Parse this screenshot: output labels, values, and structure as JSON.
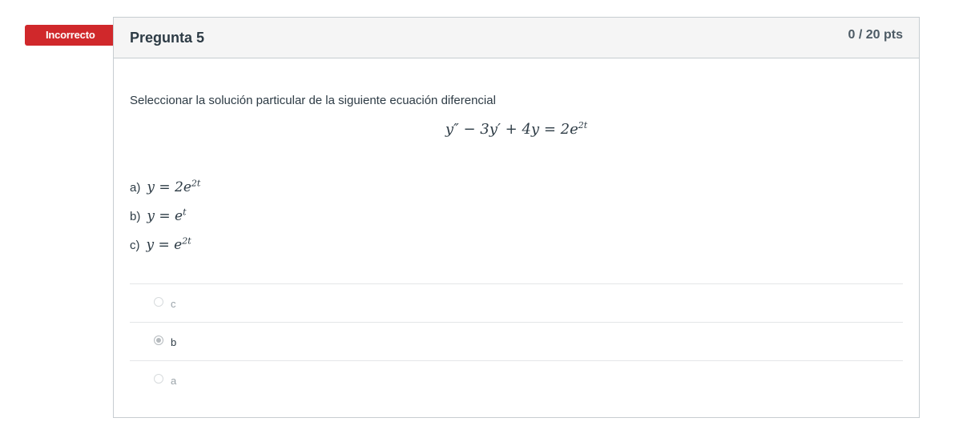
{
  "status_badge": "Incorrecto",
  "question": {
    "title": "Pregunta 5",
    "points": "0 / 20 pts",
    "prompt": "Seleccionar la solución particular de la siguiente ecuación diferencial",
    "equation": {
      "lhs": "y″ − 3y′ + 4y = 2e",
      "exp": "2t"
    },
    "options": [
      {
        "label": "a)",
        "math": "y = 2e",
        "exp": "2t"
      },
      {
        "label": "b)",
        "math": "y = e",
        "exp": "t"
      },
      {
        "label": "c)",
        "math": "y = e",
        "exp": "2t"
      }
    ]
  },
  "answers": [
    {
      "text": "c",
      "selected": false
    },
    {
      "text": "b",
      "selected": true
    },
    {
      "text": "a",
      "selected": false
    }
  ],
  "colors": {
    "incorrect": "#d0282b",
    "header_bg": "#f5f5f5",
    "border": "#c7cdd1"
  }
}
